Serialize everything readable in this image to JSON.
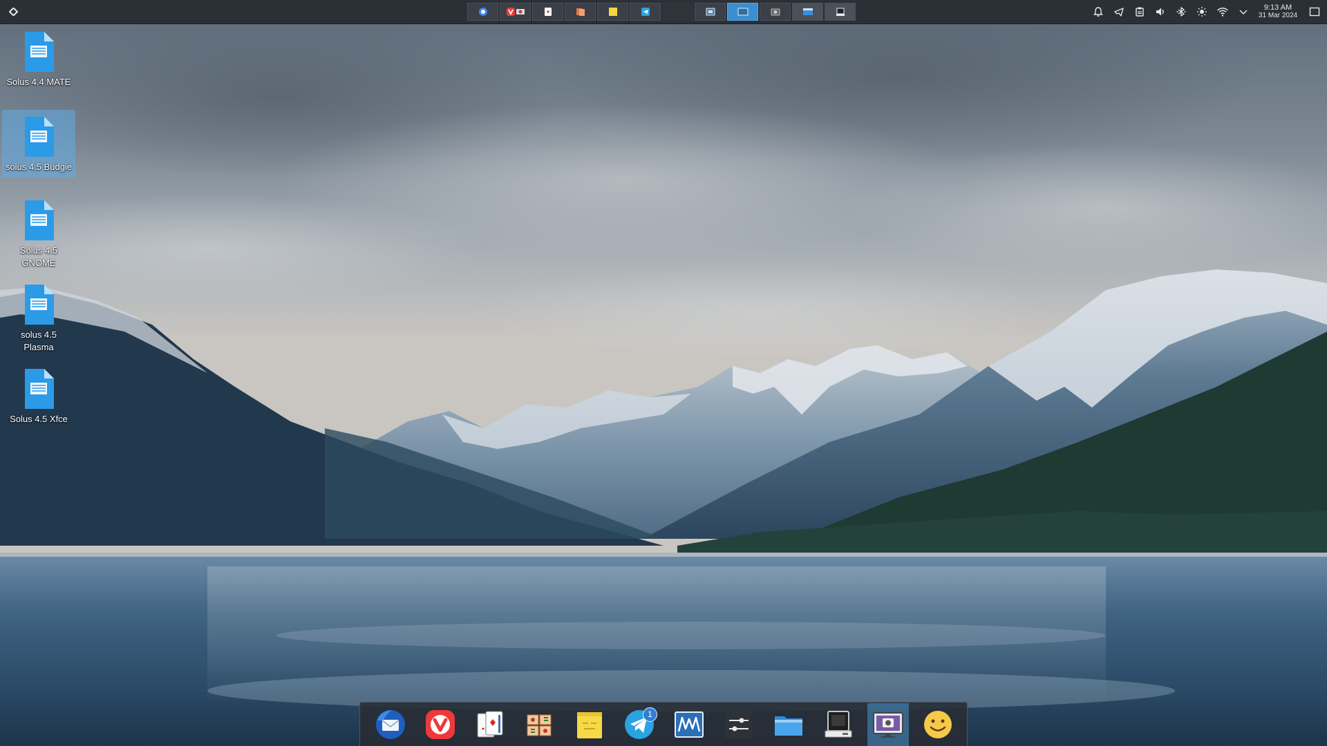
{
  "top_panel": {
    "launcher_icon": "app-menu-icon",
    "task_buttons": [
      {
        "icon": "chrome-icon",
        "state": "normal"
      },
      {
        "icon": "vivaldi-icon",
        "state": "normal"
      },
      {
        "icon": "card-game-icon",
        "state": "normal"
      },
      {
        "icon": "mahjong-icon",
        "state": "normal"
      },
      {
        "icon": "sticky-notes-icon",
        "state": "normal"
      },
      {
        "icon": "telegram-icon",
        "state": "normal"
      },
      {
        "icon": "blank",
        "state": "blank"
      },
      {
        "icon": "screenshot-tool-icon",
        "state": "normal"
      },
      {
        "icon": "window-icon",
        "state": "active"
      },
      {
        "icon": "camera-icon",
        "state": "normal"
      },
      {
        "icon": "file-manager-icon",
        "state": "light"
      },
      {
        "icon": "disk-manager-icon",
        "state": "light"
      }
    ],
    "tray_icons": [
      "notification-bell-icon",
      "telegram-tray-icon",
      "clipboard-icon",
      "volume-icon",
      "bluetooth-icon",
      "brightness-icon",
      "wifi-icon",
      "tray-expand-chevron-icon"
    ],
    "clock": {
      "time": "9:13 AM",
      "date": "31 Mar 2024"
    },
    "show_desktop_icon": "show-desktop-icon"
  },
  "desktop_icons": [
    {
      "label": "Solus 4.4 MATE",
      "selected": false
    },
    {
      "label": "solus 4.5 Budgie",
      "selected": true
    },
    {
      "label": "Solus 4.5 GNOME",
      "selected": false
    },
    {
      "label": "solus 4.5 Plasma",
      "selected": false
    },
    {
      "label": "Solus 4.5 Xfce",
      "selected": false
    }
  ],
  "dock": {
    "items": [
      {
        "icon": "thunderbird-icon"
      },
      {
        "icon": "vivaldi-icon"
      },
      {
        "icon": "solitaire-icon"
      },
      {
        "icon": "mahjongg-icon"
      },
      {
        "icon": "sticky-notes-icon"
      },
      {
        "icon": "telegram-icon",
        "badge": "1"
      },
      {
        "icon": "system-monitor-icon"
      },
      {
        "icon": "settings-sliders-icon"
      },
      {
        "icon": "files-icon"
      },
      {
        "icon": "disk-utility-icon"
      },
      {
        "icon": "screenshot-icon",
        "active": true
      },
      {
        "icon": "emoji-picker-icon"
      }
    ]
  },
  "colors": {
    "panel_bg": "#2b2f36",
    "accent": "#3b8ed0",
    "selection": "#60ace6",
    "doc_icon": "#2b9be8"
  }
}
